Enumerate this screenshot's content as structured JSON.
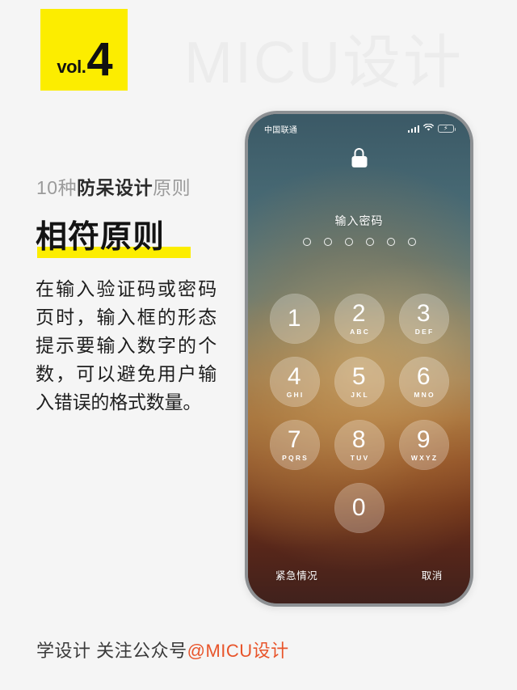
{
  "poster": {
    "watermark": "MICU设计",
    "badge": {
      "label": "vol.",
      "number": "4"
    },
    "subtitle": {
      "prefix": "10种",
      "strong": "防呆设计",
      "suffix": "原则"
    },
    "headline": "相符原则",
    "body": "在输入验证码或密码页时，输入框的形态提示要输入数字的个数，可以避免用户输入错误的格式数量。",
    "footer": {
      "text": "学设计 关注公众号",
      "handle": "@MICU设计"
    },
    "colors": {
      "background": "#f5f5f5",
      "accent_yellow": "#fced00",
      "headline": "#141414",
      "subtitle_muted": "#9b9b9b",
      "handle_orange": "#e8542a",
      "watermark": "#ececec"
    }
  },
  "phone": {
    "status_bar": {
      "carrier": "中国联通",
      "icons": [
        "signal-bars-icon",
        "wifi-icon",
        "battery-charging-icon"
      ]
    },
    "lock_icon": "lock-closed-icon",
    "prompt": "输入密码",
    "passcode_dots": 6,
    "passcode_entered": 0,
    "keypad": [
      {
        "digit": "1",
        "letters": ""
      },
      {
        "digit": "2",
        "letters": "ABC"
      },
      {
        "digit": "3",
        "letters": "DEF"
      },
      {
        "digit": "4",
        "letters": "GHI"
      },
      {
        "digit": "5",
        "letters": "JKL"
      },
      {
        "digit": "6",
        "letters": "MNO"
      },
      {
        "digit": "7",
        "letters": "PQRS"
      },
      {
        "digit": "8",
        "letters": "TUV"
      },
      {
        "digit": "9",
        "letters": "WXYZ"
      },
      {
        "digit": "0",
        "letters": ""
      }
    ],
    "actions": {
      "emergency": "紧急情况",
      "cancel": "取消"
    }
  }
}
